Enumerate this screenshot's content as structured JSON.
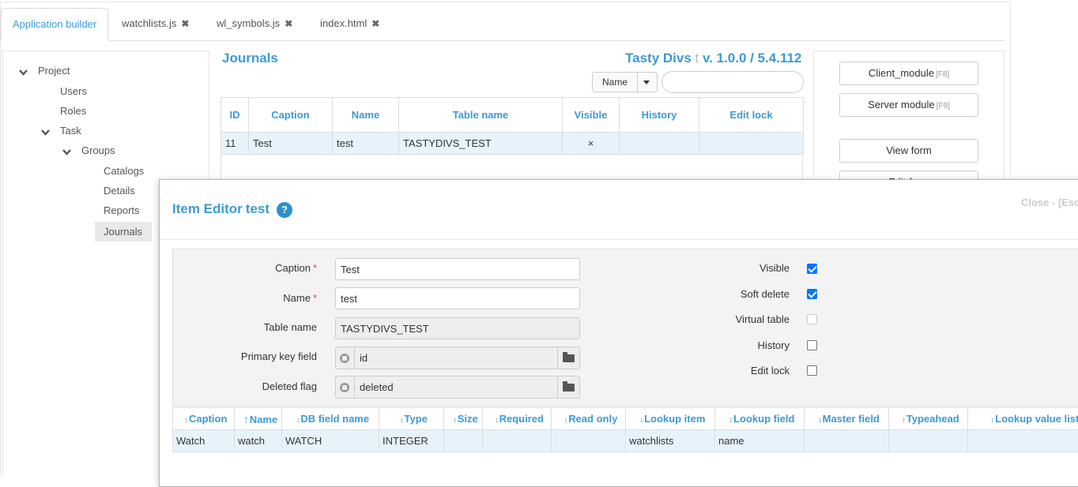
{
  "tabs": [
    {
      "label": "Application builder",
      "closable": false,
      "active": true
    },
    {
      "label": "watchlists.js",
      "closable": true,
      "active": false
    },
    {
      "label": "wl_symbols.js",
      "closable": true,
      "active": false
    },
    {
      "label": "index.html",
      "closable": true,
      "active": false
    }
  ],
  "close_glyph": "✖",
  "tree": {
    "project": "Project",
    "users": "Users",
    "roles": "Roles",
    "task": "Task",
    "groups": "Groups",
    "catalogs": "Catalogs",
    "details": "Details",
    "reports": "Reports",
    "journals": "Journals"
  },
  "journals": {
    "title": "Journals",
    "app_name": "Tasty Divs",
    "app_sep": "t",
    "app_version": "v. 1.0.0 / 5.4.112",
    "sort_label": "Name",
    "search_value": "",
    "columns": [
      "ID",
      "Caption",
      "Name",
      "Table name",
      "Visible",
      "History",
      "Edit lock"
    ],
    "rows": [
      {
        "id": "11",
        "caption": "Test",
        "name": "test",
        "table_name": "TASTYDIVS_TEST",
        "visible": "×",
        "history": "",
        "edit_lock": ""
      }
    ]
  },
  "right_buttons": {
    "client_module": "Client_module",
    "client_key": "[F8]",
    "server_module": "Server module",
    "server_key": "[F9]",
    "view_form": "View form",
    "edit_form": "Edit form"
  },
  "modal": {
    "title": "Item Editor",
    "item_name": "test",
    "help": "?",
    "close": "Close - [Esc]",
    "fields": {
      "caption_label": "Caption",
      "caption_value": "Test",
      "name_label": "Name",
      "name_value": "test",
      "table_name_label": "Table name",
      "table_name_value": "TASTYDIVS_TEST",
      "pk_label": "Primary key field",
      "pk_value": "id",
      "deleted_label": "Deleted flag",
      "deleted_value": "deleted",
      "required_mark": "*"
    },
    "checkboxes": [
      {
        "label": "Visible",
        "checked": true,
        "disabled": false
      },
      {
        "label": "Soft delete",
        "checked": true,
        "disabled": false
      },
      {
        "label": "Virtual table",
        "checked": false,
        "disabled": true
      },
      {
        "label": "History",
        "checked": false,
        "disabled": false
      },
      {
        "label": "Edit lock",
        "checked": false,
        "disabled": false
      }
    ],
    "field_columns": [
      {
        "label": "Caption",
        "sort": "↕"
      },
      {
        "label": "Name",
        "sort": "↑"
      },
      {
        "label": "DB field name",
        "sort": "↕"
      },
      {
        "label": "Type",
        "sort": "↕"
      },
      {
        "label": "Size",
        "sort": "↕"
      },
      {
        "label": "Required",
        "sort": "↕"
      },
      {
        "label": "Read only",
        "sort": "↕"
      },
      {
        "label": "Lookup item",
        "sort": "↕"
      },
      {
        "label": "Lookup field",
        "sort": "↕"
      },
      {
        "label": "Master field",
        "sort": "↕"
      },
      {
        "label": "Typeahead",
        "sort": "↕"
      },
      {
        "label": "Lookup value list",
        "sort": "↕"
      }
    ],
    "field_rows": [
      {
        "caption": "Watch",
        "name": "watch",
        "db_field": "WATCH",
        "type": "INTEGER",
        "size": "",
        "required": "",
        "read_only": "",
        "lookup_item": "watchlists",
        "lookup_field": "name",
        "master_field": "",
        "typeahead": "",
        "lookup_value_list": ""
      }
    ]
  },
  "colors": {
    "accent": "#3c9ad6",
    "row_highlight": "#e7f3fb",
    "checkbox_on": "#0075ff",
    "required": "#d9534f"
  }
}
